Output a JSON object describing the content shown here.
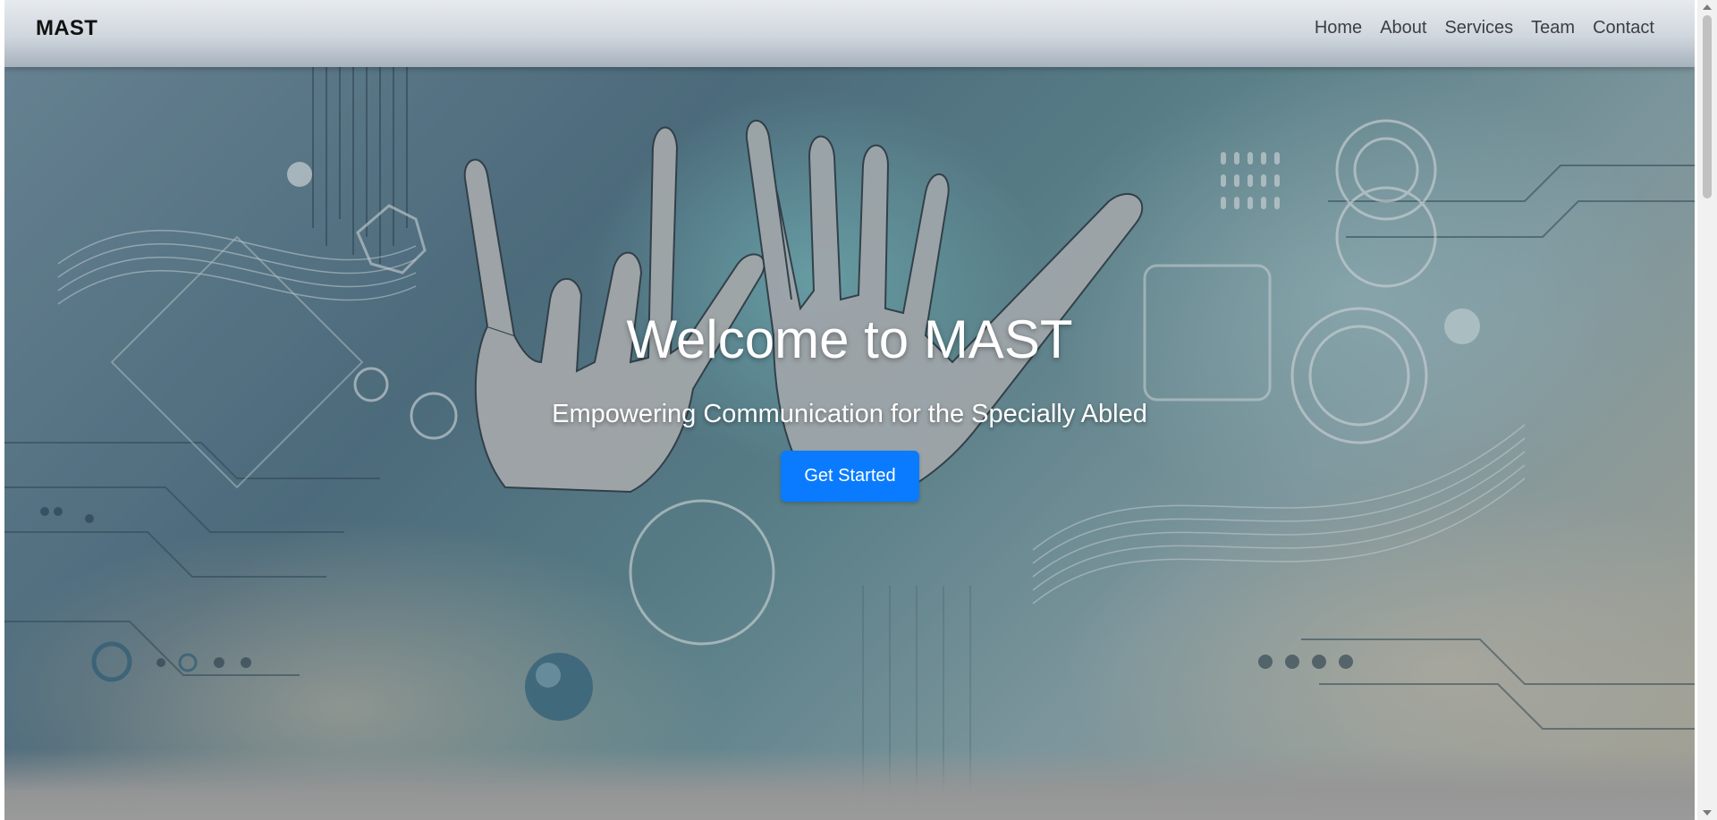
{
  "header": {
    "brand": "MAST",
    "nav": [
      {
        "label": "Home"
      },
      {
        "label": "About"
      },
      {
        "label": "Services"
      },
      {
        "label": "Team"
      },
      {
        "label": "Contact"
      }
    ]
  },
  "hero": {
    "title": "Welcome to MAST",
    "subtitle": "Empowering Communication for the Specially Abled",
    "cta_label": "Get Started",
    "background_image": "robotic-hands-sign-language-illustration"
  },
  "colors": {
    "cta": "#0a7bff",
    "hero_text": "#ffffff",
    "nav_text": "#3a3f45",
    "brand_text": "#111111"
  }
}
